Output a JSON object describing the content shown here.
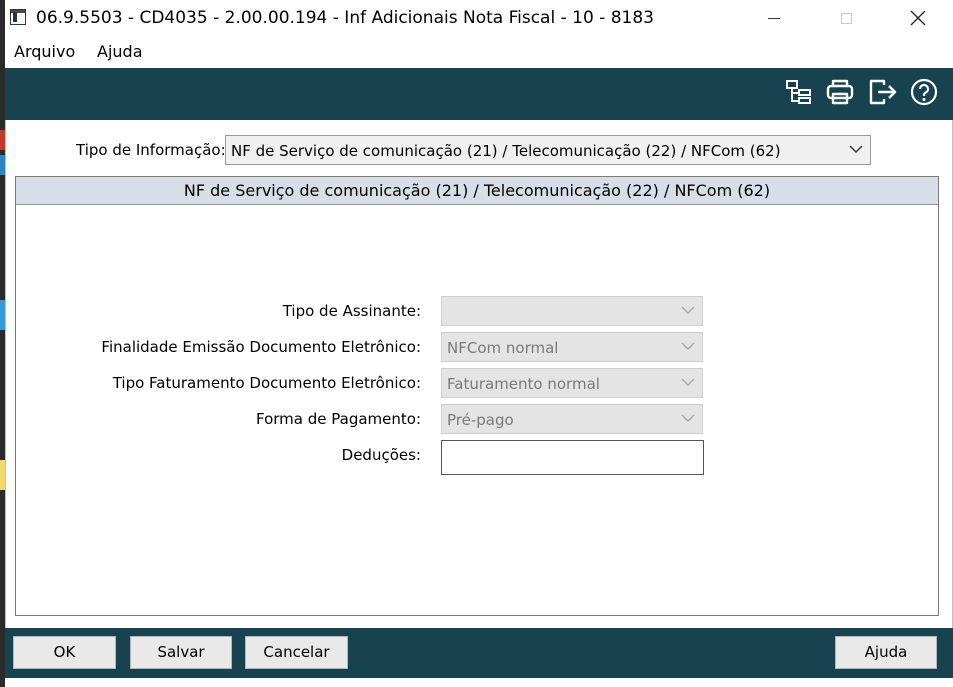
{
  "window": {
    "title": "06.9.5503 - CD4035 - 2.00.00.194 - Inf Adicionais Nota Fiscal - 10 - 8183"
  },
  "menu": {
    "items": [
      {
        "label": "Arquivo"
      },
      {
        "label": "Ajuda"
      }
    ]
  },
  "toolbar": {
    "icons": [
      "tree-structure-icon",
      "printer-icon",
      "exit-icon",
      "help-icon"
    ]
  },
  "tipo": {
    "label": "Tipo de Informação:",
    "selected": "NF de Serviço de comunicação (21) / Telecomunicação (22) / NFCom (62)"
  },
  "group": {
    "title": "NF de Serviço de comunicação (21) / Telecomunicação (22) / NFCom (62)"
  },
  "fields": {
    "assinante": {
      "label": "Tipo de Assinante:",
      "value": ""
    },
    "finalidade": {
      "label": "Finalidade Emissão Documento Eletrônico:",
      "value": "NFCom normal"
    },
    "faturamento": {
      "label": "Tipo Faturamento Documento Eletrônico:",
      "value": "Faturamento normal"
    },
    "pagamento": {
      "label": "Forma de Pagamento:",
      "value": "Pré-pago"
    },
    "deducoes": {
      "label": "Deduções:",
      "value": ""
    }
  },
  "footer": {
    "ok": "OK",
    "salvar": "Salvar",
    "cancelar": "Cancelar",
    "ajuda": "Ajuda"
  },
  "colors": {
    "toolbar_bg": "#17424f",
    "group_header_bg": "#d9dde6"
  }
}
